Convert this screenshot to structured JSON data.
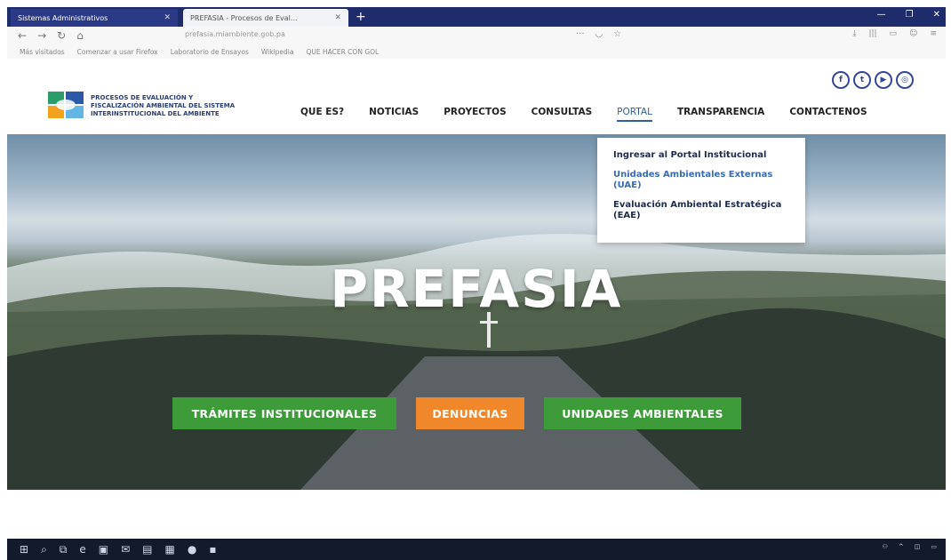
{
  "browser": {
    "tabs": [
      {
        "label": "Sistemas Administrativos"
      },
      {
        "label": "PREFASIA - Procesos de Eval..."
      }
    ],
    "new_tab": "+",
    "url": "prefasia.miambiente.gob.pa",
    "bookmarks": [
      "Más visitados",
      "Comenzar a usar Firefox",
      "Laboratorio de Ensayos",
      "Wikipedia",
      "QUE HACER CON GOL"
    ]
  },
  "site": {
    "logo_lines": [
      "PROCESOS DE EVALUACIÓN Y",
      "FISCALIZACIÓN AMBIENTAL DEL SISTEMA",
      "INTERINSTITUCIONAL DEL AMBIENTE"
    ],
    "social": [
      {
        "icon": "facebook-icon",
        "glyph": "f"
      },
      {
        "icon": "twitter-icon",
        "glyph": "t"
      },
      {
        "icon": "youtube-icon",
        "glyph": "▶"
      },
      {
        "icon": "instagram-icon",
        "glyph": "◎"
      }
    ],
    "menu": [
      "QUE ES?",
      "NOTICIAS",
      "PROYECTOS",
      "CONSULTAS",
      "PORTAL",
      "TRANSPARENCIA",
      "CONTACTENOS"
    ],
    "dropdown": [
      "Ingresar al Portal Institucional",
      "Unidades Ambientales Externas (UAE)",
      "Evaluación Ambiental Estratégica (EAE)"
    ],
    "hero_title": "PREFASIA",
    "buttons": [
      "TRÁMITES INSTITUCIONALES",
      "DENUNCIAS",
      "UNIDADES AMBIENTALES"
    ]
  },
  "colors": {
    "green": "#3d9b3a",
    "orange": "#f0872a",
    "accent": "#2e5ea8"
  }
}
